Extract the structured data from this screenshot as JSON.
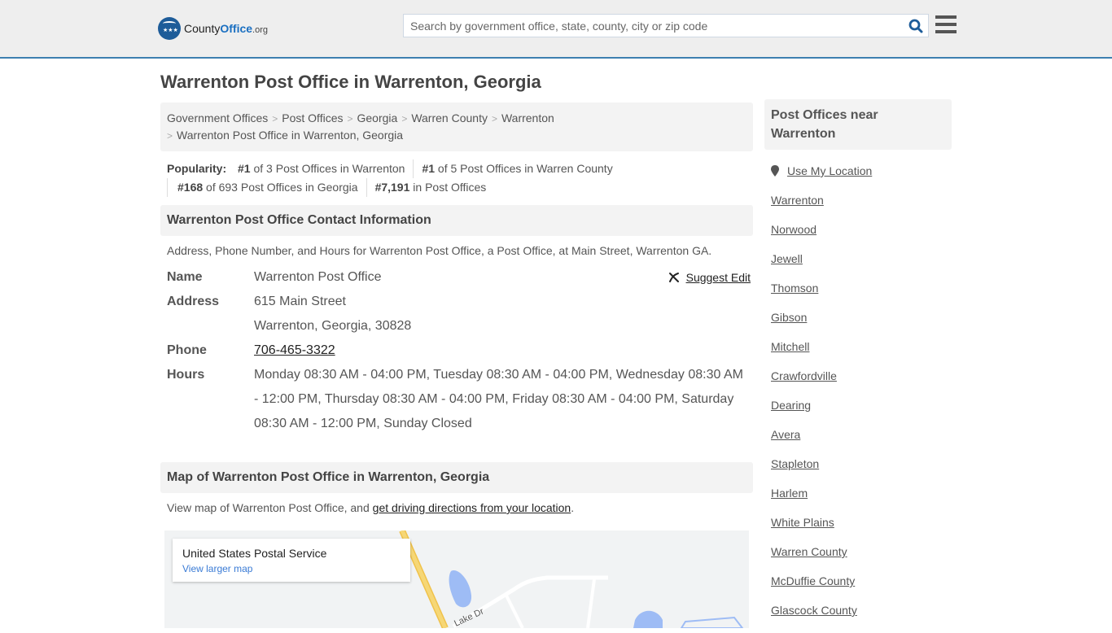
{
  "header": {
    "logo": {
      "county": "County",
      "office": "Office",
      "tld": ".org"
    },
    "search_placeholder": "Search by government office, state, county, city or zip code"
  },
  "page_title": "Warrenton Post Office in Warrenton, Georgia",
  "breadcrumb": [
    "Government Offices",
    "Post Offices",
    "Georgia",
    "Warren County",
    "Warrenton",
    "Warrenton Post Office in Warrenton, Georgia"
  ],
  "popularity": {
    "label": "Popularity:",
    "items": [
      {
        "rank": "#1",
        "text": " of 3 Post Offices in Warrenton"
      },
      {
        "rank": "#1",
        "text": " of 5 Post Offices in Warren County"
      },
      {
        "rank": "#168",
        "text": " of 693 Post Offices in Georgia"
      },
      {
        "rank": "#7,191",
        "text": " in Post Offices"
      }
    ]
  },
  "contact": {
    "heading": "Warrenton Post Office Contact Information",
    "description": "Address, Phone Number, and Hours for Warrenton Post Office, a Post Office, at Main Street, Warrenton GA.",
    "suggest_edit": "Suggest Edit",
    "fields": {
      "name_label": "Name",
      "name": "Warrenton Post Office",
      "address_label": "Address",
      "address_line1": "615 Main Street",
      "address_line2": "Warrenton, Georgia, 30828",
      "phone_label": "Phone",
      "phone": "706-465-3322",
      "hours_label": "Hours",
      "hours": "Monday 08:30 AM - 04:00 PM, Tuesday 08:30 AM - 04:00 PM, Wednesday 08:30 AM - 12:00 PM, Thursday 08:30 AM - 04:00 PM, Friday 08:30 AM - 04:00 PM, Saturday 08:30 AM - 12:00 PM, Sunday Closed"
    }
  },
  "map": {
    "heading": "Map of Warrenton Post Office in Warrenton, Georgia",
    "desc_prefix": "View map of Warrenton Post Office, and ",
    "desc_link": "get driving directions from your location",
    "desc_suffix": ".",
    "card_title": "United States Postal Service",
    "card_link": "View larger map",
    "road_label": "Lake Dr"
  },
  "sidebar": {
    "heading": "Post Offices near Warrenton",
    "use_location": "Use My Location",
    "links": [
      "Warrenton",
      "Norwood",
      "Jewell",
      "Thomson",
      "Gibson",
      "Mitchell",
      "Crawfordville",
      "Dearing",
      "Avera",
      "Stapleton",
      "Harlem",
      "White Plains",
      "Warren County",
      "McDuffie County",
      "Glascock County"
    ]
  }
}
